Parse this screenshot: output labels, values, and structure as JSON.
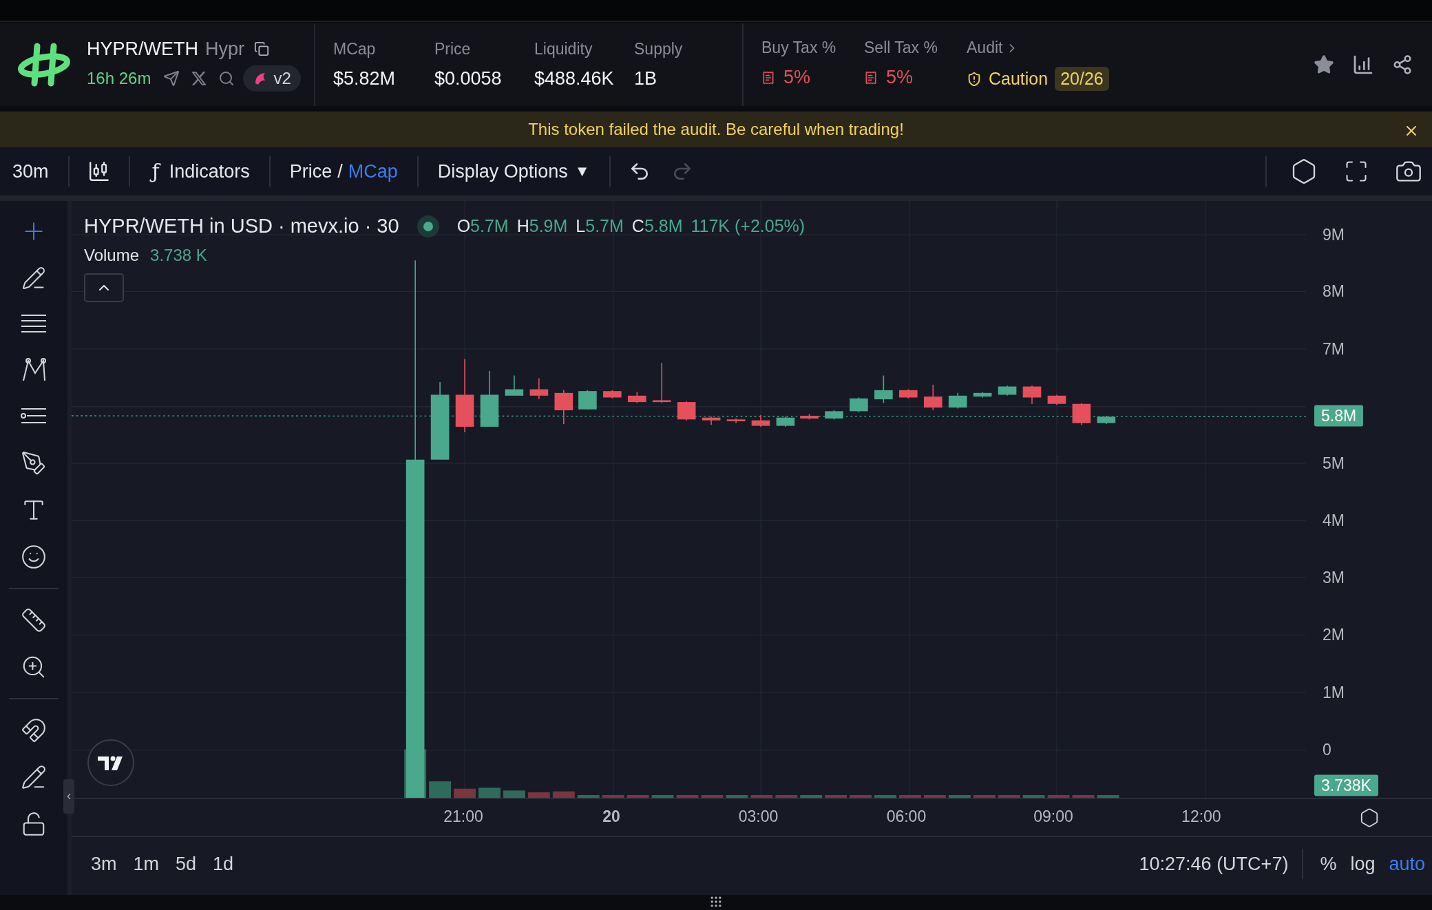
{
  "header": {
    "pair": "HYPR/WETH",
    "name": "Hypr",
    "age": "16h 26m",
    "dex_version": "v2",
    "stats": [
      {
        "label": "MCap",
        "value": "$5.82M"
      },
      {
        "label": "Price",
        "value": "$0.0058"
      },
      {
        "label": "Liquidity",
        "value": "$488.46K"
      },
      {
        "label": "Supply",
        "value": "1B"
      }
    ],
    "taxes": [
      {
        "label": "Buy Tax %",
        "value": "5%"
      },
      {
        "label": "Sell Tax %",
        "value": "5%"
      }
    ],
    "audit": {
      "label": "Audit",
      "status": "Caution",
      "score": "20/26"
    }
  },
  "banner": {
    "message": "This token failed the audit. Be careful when trading!"
  },
  "toolbar": {
    "interval": "30m",
    "indicators_symbol": "ƒ",
    "indicators": "Indicators",
    "price_mode": [
      {
        "label": "Price",
        "selected": false
      },
      {
        "label": "MCap",
        "selected": true
      }
    ],
    "price_mode_separator": "/",
    "display_options": "Display Options",
    "display_options_caret": "▼",
    "undo": {
      "disabled": false
    },
    "redo": {
      "disabled": true
    }
  },
  "chart": {
    "legend": {
      "title": "HYPR/WETH in USD · mevx.io · 30",
      "ohlc": [
        {
          "key": "O",
          "value": "5.7M"
        },
        {
          "key": "H",
          "value": "5.9M"
        },
        {
          "key": "L",
          "value": "5.7M"
        },
        {
          "key": "C",
          "value": "5.8M"
        }
      ],
      "change": "117K (+2.05%)"
    },
    "volume": {
      "label": "Volume",
      "value": "3.738 K"
    },
    "price_ticks": [
      "9M",
      "8M",
      "7M",
      "5M",
      "4M",
      "3M",
      "2M",
      "1M",
      "0"
    ],
    "last_price": "5.8M",
    "last_volume": "3.738K",
    "time_ticks": [
      {
        "label": "21:00",
        "bold": false
      },
      {
        "label": "20",
        "bold": true
      },
      {
        "label": "03:00",
        "bold": false
      },
      {
        "label": "06:00",
        "bold": false
      },
      {
        "label": "09:00",
        "bold": false
      },
      {
        "label": "12:00",
        "bold": false
      }
    ]
  },
  "bottom_bar": {
    "ranges": [
      "3m",
      "1m",
      "5d",
      "1d"
    ],
    "clock": "10:27:46 (UTC+7)",
    "scale_options": [
      {
        "label": "%",
        "selected": false
      },
      {
        "label": "log",
        "selected": false
      },
      {
        "label": "auto",
        "selected": true
      }
    ]
  }
}
